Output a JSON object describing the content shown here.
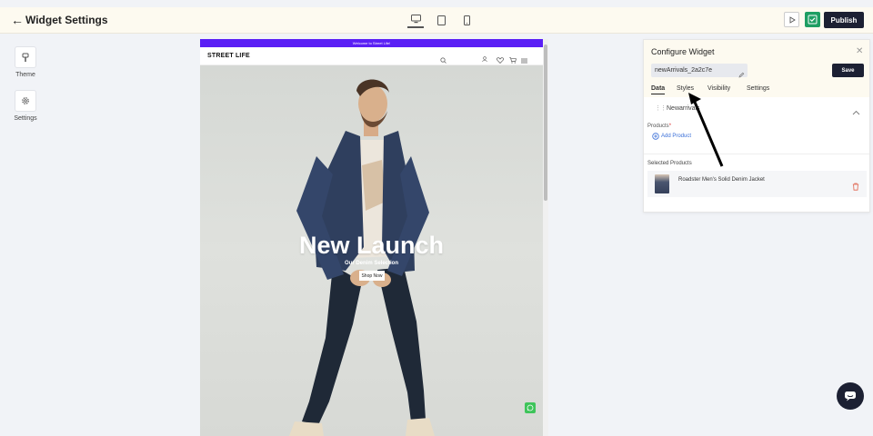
{
  "header": {
    "title": "Widget Settings",
    "publish_label": "Publish"
  },
  "rail": {
    "theme_label": "Theme",
    "settings_label": "Settings"
  },
  "preview": {
    "announcement": "Welcome to Street Life!",
    "brand": "STREET LIFE",
    "signin_label": "Sign In",
    "hero_title": "New Launch",
    "hero_subtitle": "Our Denim Selection",
    "cta_label": "Shop Now"
  },
  "panel": {
    "title": "Configure Widget",
    "widget_id": "newArrivals_2a2c7e",
    "save_label": "Save",
    "tabs": [
      {
        "label": "Data",
        "active": true
      },
      {
        "label": "Styles",
        "active": false
      },
      {
        "label": "Visibility",
        "active": false
      },
      {
        "label": "Settings",
        "active": false
      }
    ],
    "section_name": "Newarrivals",
    "products_label": "Products",
    "add_product_label": "Add Product",
    "selected_label": "Selected Products",
    "selected_products": [
      {
        "name": "Roadster Men's Solid Denim Jacket"
      }
    ]
  },
  "colors": {
    "primary_dark": "#1c2033",
    "announcement": "#5a1ff5",
    "check": "#1e9e63",
    "link": "#3a6fd8",
    "delete": "#e0624b",
    "whatsapp": "#3ec45a"
  },
  "icons": {
    "back": "arrow-left-icon",
    "desktop": "monitor-icon",
    "tablet": "tablet-icon",
    "mobile": "phone-icon",
    "preview": "play-icon",
    "check": "check-icon",
    "theme": "paint-brush-icon",
    "settings": "gear-icon",
    "close": "close-icon",
    "edit": "pencil-icon",
    "collapse": "chevron-up-icon",
    "add": "plus-circle-icon",
    "delete": "trash-icon",
    "chat": "chat-icon",
    "whatsapp": "whatsapp-icon"
  }
}
